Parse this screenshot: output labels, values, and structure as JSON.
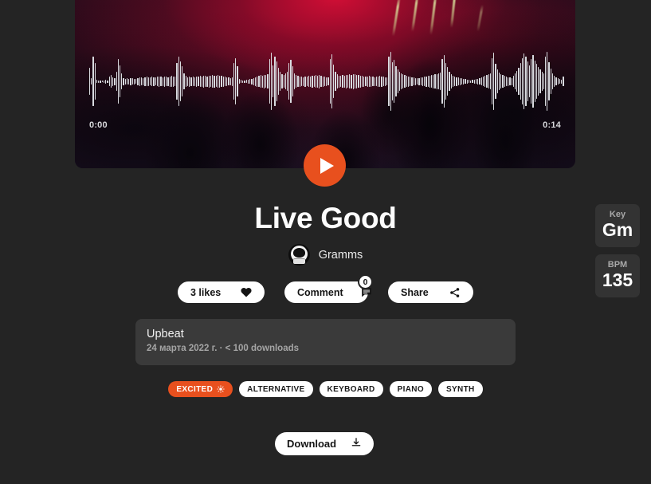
{
  "player": {
    "time_start": "0:00",
    "time_end": "0:14",
    "play_icon": "play-icon",
    "waveform_heights": [
      34,
      8,
      62,
      46,
      4,
      3,
      3,
      2,
      3,
      5,
      3,
      12,
      16,
      11,
      9,
      24,
      56,
      40,
      20,
      9,
      7,
      8,
      7,
      9,
      8,
      7,
      6,
      9,
      11,
      10,
      9,
      11,
      12,
      11,
      10,
      12,
      11,
      10,
      12,
      13,
      12,
      11,
      13,
      12,
      11,
      13,
      14,
      13,
      12,
      46,
      62,
      50,
      38,
      20,
      14,
      11,
      13,
      11,
      12,
      11,
      13,
      12,
      14,
      13,
      15,
      14,
      13,
      15,
      14,
      16,
      15,
      14,
      16,
      15,
      14,
      13,
      12,
      11,
      10,
      9,
      11,
      46,
      58,
      38,
      6,
      4,
      3,
      3,
      4,
      5,
      6,
      7,
      9,
      11,
      13,
      14,
      16,
      15,
      17,
      16,
      18,
      56,
      72,
      40,
      62,
      50,
      34,
      24,
      18,
      16,
      20,
      24,
      46,
      54,
      38,
      20,
      16,
      14,
      13,
      12,
      11,
      13,
      12,
      14,
      13,
      15,
      14,
      16,
      15,
      17,
      14,
      13,
      12,
      11,
      10,
      56,
      68,
      42,
      24,
      18,
      15,
      14,
      16,
      15,
      17,
      16,
      18,
      17,
      19,
      18,
      17,
      16,
      15,
      14,
      13,
      12,
      13,
      14,
      13,
      12,
      11,
      12,
      13,
      14,
      13,
      12,
      11,
      10,
      62,
      74,
      48,
      54,
      38,
      30,
      24,
      20,
      18,
      16,
      14,
      13,
      12,
      11,
      10,
      9,
      8,
      9,
      10,
      11,
      12,
      13,
      14,
      15,
      16,
      17,
      18,
      19,
      20,
      22,
      56,
      66,
      46,
      36,
      24,
      18,
      14,
      12,
      11,
      10,
      9,
      8,
      7,
      6,
      5,
      4,
      3,
      4,
      5,
      6,
      7,
      8,
      10,
      12,
      14,
      16,
      18,
      20,
      58,
      72,
      44,
      30,
      22,
      18,
      16,
      14,
      12,
      11,
      10,
      9,
      14,
      20,
      26,
      34,
      46,
      58,
      70,
      62,
      50,
      40,
      56,
      66,
      52,
      44,
      36,
      30,
      24,
      20,
      62,
      74,
      48,
      32,
      20,
      14,
      10,
      8,
      6,
      5,
      12
    ]
  },
  "meta": {
    "key_label": "Key",
    "key_value": "Gm",
    "bpm_label": "BPM",
    "bpm_value": "135"
  },
  "track": {
    "title": "Live Good",
    "artist": "Gramms",
    "avatar_icon": "astronaut-helmet-avatar"
  },
  "actions": {
    "likes_label": "3 likes",
    "likes_icon": "heart-icon",
    "comment_label": "Comment",
    "comment_icon": "comment-icon",
    "comment_badge": "0",
    "share_label": "Share",
    "share_icon": "share-icon"
  },
  "info": {
    "mood": "Upbeat",
    "details": "24 марта 2022 г. · < 100 downloads"
  },
  "tags": [
    {
      "label": "EXCITED",
      "style": "accent",
      "icon": "sun-icon"
    },
    {
      "label": "ALTERNATIVE",
      "style": "plain",
      "icon": ""
    },
    {
      "label": "KEYBOARD",
      "style": "plain",
      "icon": ""
    },
    {
      "label": "PIANO",
      "style": "plain",
      "icon": ""
    },
    {
      "label": "SYNTH",
      "style": "plain",
      "icon": ""
    }
  ],
  "download": {
    "label": "Download",
    "icon": "download-icon"
  },
  "colors": {
    "page_background": "#242424",
    "accent": "#e8501e",
    "card_background": "#3a3a3a",
    "meta_background": "#333333"
  }
}
